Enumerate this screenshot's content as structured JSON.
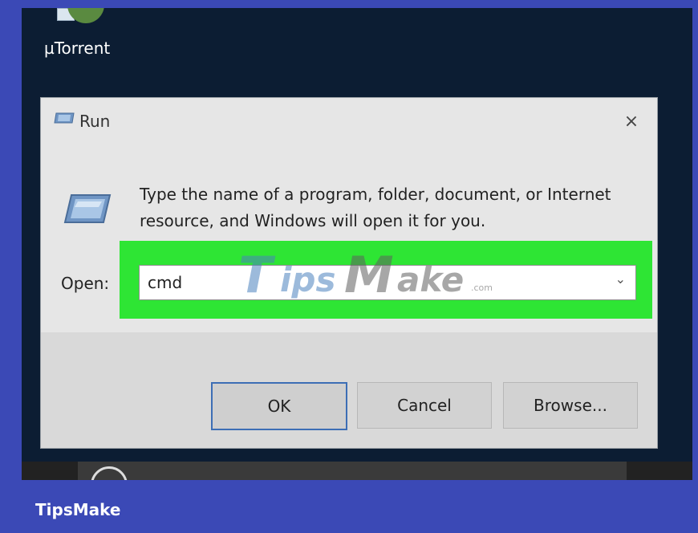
{
  "desktop": {
    "shortcut_label": "µTorrent"
  },
  "dialog": {
    "title": "Run",
    "close_glyph": "×",
    "message": "Type the name of a program, folder, document, or Internet resource, and Windows will open it for you.",
    "open_label": "Open:",
    "input_value": "cmd",
    "dropdown_glyph": "⌄"
  },
  "buttons": {
    "ok": "OK",
    "cancel": "Cancel",
    "browse": "Browse..."
  },
  "watermark": {
    "letter1": "T",
    "part1": "ips",
    "letter2": "M",
    "part2": "ake",
    "suffix": ".com"
  },
  "footer_brand": "TipsMake",
  "colors": {
    "highlight": "#2ee534",
    "frame": "#3b49b6",
    "desktop": "#0c1d33",
    "primary_border": "#3d6eb5"
  },
  "icons": [
    "run-icon",
    "close-icon",
    "chevron-down-icon",
    "utorrent-icon"
  ]
}
